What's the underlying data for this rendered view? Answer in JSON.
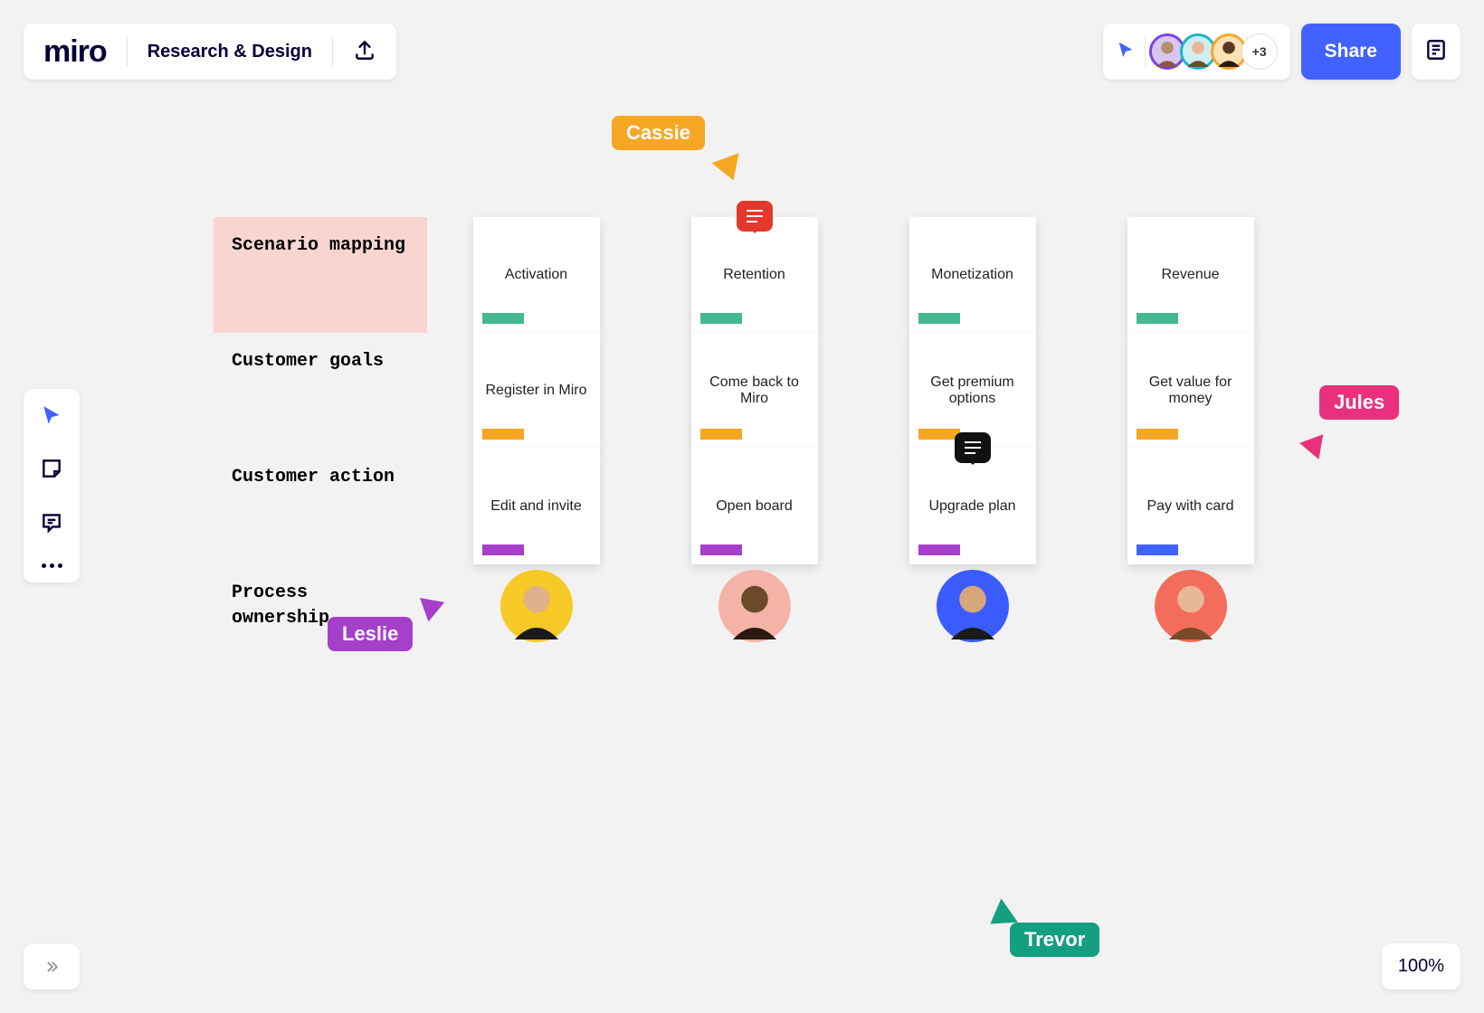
{
  "app": {
    "logo": "miro",
    "board_title": "Research & Design"
  },
  "header": {
    "avatars_overflow": "+3",
    "share": "Share",
    "avatar_colors": [
      "#7a3ff2",
      "#19b7c4",
      "#f5a623"
    ]
  },
  "zoom": "100%",
  "cursors": {
    "cassie": "Cassie",
    "jules": "Jules",
    "leslie": "Leslie",
    "trevor": "Trevor"
  },
  "grid": {
    "rows": [
      {
        "label": "Scenario mapping",
        "tag_color": "teal",
        "cards": [
          "Activation",
          "Retention",
          "Monetization",
          "Revenue"
        ],
        "bubbles": [
          null,
          "red",
          null,
          null
        ]
      },
      {
        "label": "Customer goals",
        "tag_color": "orange",
        "cards": [
          "Register in Miro",
          "Come back to Miro",
          "Get premium options",
          "Get value for money"
        ],
        "bubbles": [
          null,
          null,
          null,
          null
        ]
      },
      {
        "label": "Customer action",
        "tag_color": "purple",
        "cards": [
          "Edit and invite",
          "Open board",
          "Upgrade plan",
          "Pay with card"
        ],
        "last_tag_color": "blue",
        "bubbles": [
          null,
          null,
          "black",
          null
        ]
      },
      {
        "label": "Process ownership",
        "owners": [
          "#f6c927",
          "#f5b3a8",
          "#3a5cff",
          "#f26d5b"
        ]
      }
    ]
  }
}
